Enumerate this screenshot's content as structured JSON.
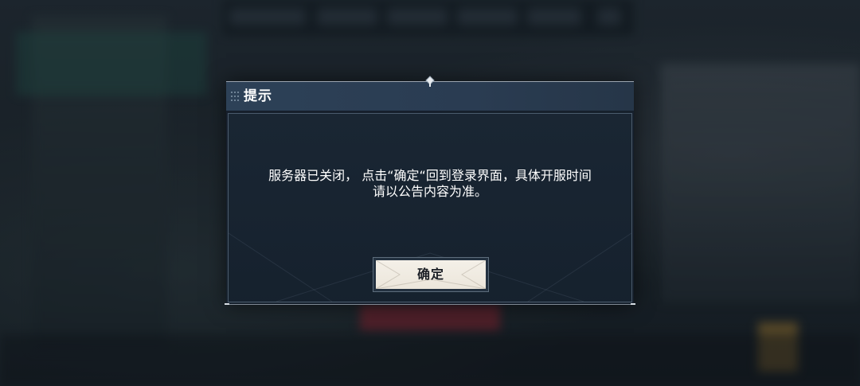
{
  "dialog": {
    "title": "提示",
    "message_line1": "服务器已关闭， 点击“确定“回到登录界面，具体开服时间",
    "message_line2": "请以公告内容为准。",
    "confirm_label": "确定"
  },
  "icons": {
    "title_grip": "grip-dots-icon",
    "top_ornament": "diamond-ornament-icon"
  },
  "colors": {
    "titlebar": "#2d4157",
    "panel": "#1a2634",
    "button_face": "#f4f0e8",
    "button_text": "#1b1f26",
    "text": "#ffffff"
  }
}
